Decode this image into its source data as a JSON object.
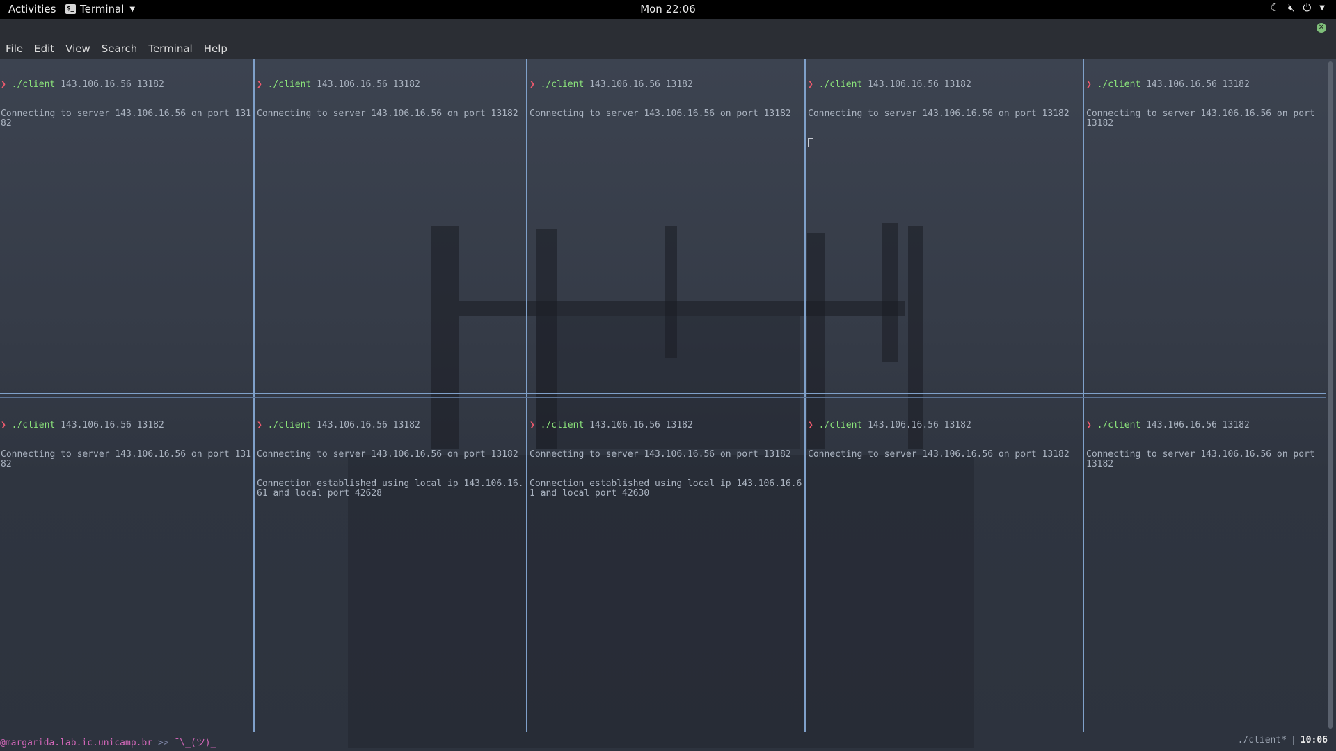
{
  "topbar": {
    "activities": "Activities",
    "app_name": "Terminal",
    "app_icon_glyph": "$_",
    "clock": "Mon 22:06",
    "tray_icons": [
      "moon-icon",
      "volume-muted-icon",
      "power-icon",
      "chevron-down-icon"
    ]
  },
  "menubar": [
    "File",
    "Edit",
    "View",
    "Search",
    "Terminal",
    "Help"
  ],
  "prompt": {
    "arrow": "❯",
    "command": "./client",
    "args": "143.106.16.56 13182"
  },
  "panes_top": [
    {
      "output": [
        "Connecting to server 143.106.16.56 on port 13182"
      ],
      "cursor": false
    },
    {
      "output": [
        "Connecting to server 143.106.16.56 on port 13182"
      ],
      "cursor": false
    },
    {
      "output": [
        "Connecting to server 143.106.16.56 on port 13182"
      ],
      "cursor": false
    },
    {
      "output": [
        "Connecting to server 143.106.16.56 on port 13182"
      ],
      "cursor": true
    },
    {
      "output": [
        "Connecting to server 143.106.16.56 on port 13182"
      ],
      "cursor": false
    }
  ],
  "panes_bottom": [
    {
      "output": [
        "Connecting to server 143.106.16.56 on port 13182"
      ],
      "cursor": false
    },
    {
      "output": [
        "Connecting to server 143.106.16.56 on port 13182",
        "Connection established using local ip 143.106.16.61 and local port 42628"
      ],
      "cursor": false
    },
    {
      "output": [
        "Connecting to server 143.106.16.56 on port 13182",
        "Connection established using local ip 143.106.16.61 and local port 42630"
      ],
      "cursor": false
    },
    {
      "output": [
        "Connecting to server 143.106.16.56 on port 13182"
      ],
      "cursor": false
    },
    {
      "output": [
        "Connecting to server 143.106.16.56 on port 13182"
      ],
      "cursor": false
    }
  ],
  "tmux_status": {
    "host": "@margarida.lab.ic.unicamp.br",
    "prompt": ">>",
    "shrug": "¯\\_(ツ)_",
    "window": "./client*",
    "separator": "|",
    "time": "10:06"
  },
  "colors": {
    "prompt_arrow": "#f05a6e",
    "command": "#8be37b",
    "output": "#aab3c0",
    "pane_border": "#7fa0c9"
  }
}
